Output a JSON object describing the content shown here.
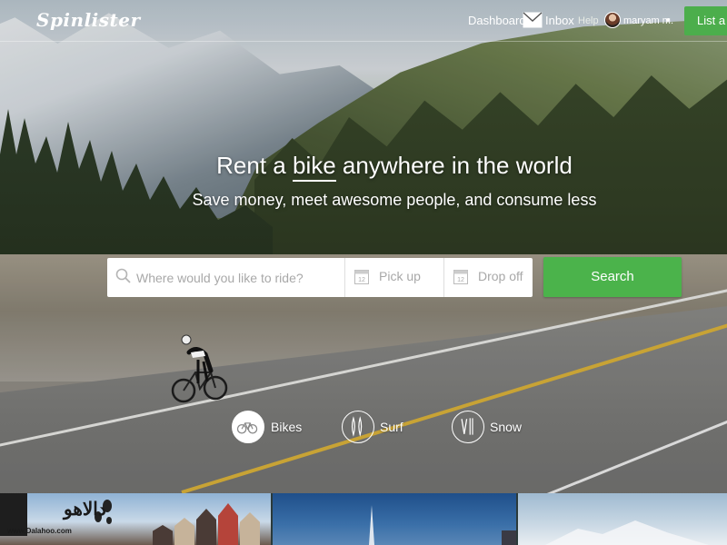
{
  "nav": {
    "logo": "Spinlister",
    "dashboard": "Dashboard",
    "inbox": "Inbox",
    "help": "Help",
    "user": "maryam m.",
    "list_button": "List a R"
  },
  "hero": {
    "headline_before": "Rent a ",
    "headline_highlight": "bike",
    "headline_after": " anywhere in the world",
    "subheadline": "Save money, meet awesome people, and consume less"
  },
  "search": {
    "placeholder": "Where would you like to ride?",
    "calendar_day": "12",
    "pickup": "Pick up",
    "dropoff": "Drop off",
    "button": "Search"
  },
  "categories": [
    {
      "label": "Bikes",
      "icon": "bike-icon",
      "selected": true
    },
    {
      "label": "Surf",
      "icon": "surfboard-icon",
      "selected": false
    },
    {
      "label": "Snow",
      "icon": "ski-icon",
      "selected": false
    }
  ],
  "watermark": {
    "text": "دالاهو",
    "url": "www.Dalahoo.com"
  },
  "colors": {
    "accent_green": "#4bb34b",
    "nav_text": "#ffffff",
    "placeholder_gray": "#a8a8a8"
  }
}
